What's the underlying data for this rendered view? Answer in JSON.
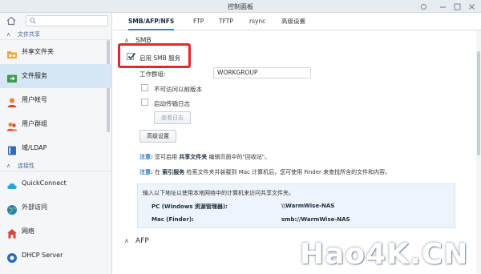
{
  "window": {
    "title": "控制面板"
  },
  "sidebar": {
    "search_placeholder": "",
    "sections": [
      {
        "label": "文件共享",
        "items": [
          {
            "label": "共享文件夹",
            "icon": "shared-folder-icon"
          },
          {
            "label": "文件服务",
            "icon": "file-services-icon",
            "active": true
          },
          {
            "label": "用户帐号",
            "icon": "user-icon"
          },
          {
            "label": "用户群组",
            "icon": "group-icon"
          },
          {
            "label": "域/LDAP",
            "icon": "domain-icon"
          }
        ]
      },
      {
        "label": "连接性",
        "items": [
          {
            "label": "QuickConnect",
            "icon": "quickconnect-icon"
          },
          {
            "label": "外部访问",
            "icon": "globe-icon"
          },
          {
            "label": "网络",
            "icon": "network-icon"
          },
          {
            "label": "DHCP Server",
            "icon": "dhcp-icon"
          }
        ]
      }
    ]
  },
  "tabs": [
    "SMB/AFP/NFS",
    "FTP",
    "TFTP",
    "rsync",
    "高级设置"
  ],
  "smb": {
    "section_title": "SMB",
    "enable_label": "启用 SMB 服务",
    "enable_checked": true,
    "workgroup_label": "工作群组:",
    "workgroup_value": "WORKGROUP",
    "prev_versions_label": "不可访问以前版本",
    "transfer_log_label": "启动传输日志",
    "view_log_button": "查看日志",
    "advanced_button": "高级设置",
    "note1": {
      "prefix": "注意:",
      "before": "您可启用 ",
      "bold": "共享文件夹",
      "after": " 编辑页面中的\"回收站\"。"
    },
    "note2": {
      "prefix": "注意:",
      "before": "在 ",
      "bold1": "索引服务",
      "middle": " 检索文件夹并装载到 Mac 计算机后，您可使用 Finder 来查找所含的文件和内容。"
    },
    "info": {
      "intro": "输入以下地址以使用本地网络中的计算机来访问共享文件夹。",
      "pc_label": "PC (Windows 资源管理器):",
      "pc_value": "\\\\WarmWise-NAS",
      "mac_label": "Mac (Finder):",
      "mac_value": "smb://WarmWise-NAS"
    }
  },
  "afp": {
    "section_title": "AFP"
  },
  "watermark": "Hao4K.CN",
  "colors": {
    "accent": "#2f88d9",
    "highlight": "#e5262b",
    "active_item": "#d6e6f5"
  }
}
